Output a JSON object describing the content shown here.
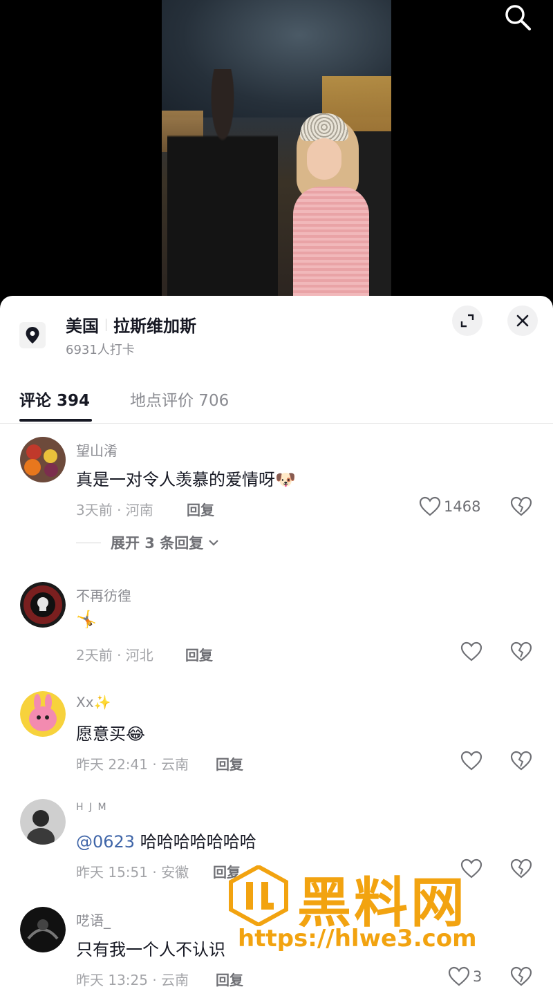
{
  "video": {
    "description_icon": "video-thumbnail"
  },
  "topbar": {
    "search_icon": "search-icon"
  },
  "location": {
    "country": "美国",
    "city": "拉斯维加斯",
    "checkins": "6931人打卡"
  },
  "tabs": [
    {
      "label": "评论 394",
      "active": true
    },
    {
      "label": "地点评价 706",
      "active": false
    }
  ],
  "comments": [
    {
      "user": "望山淆",
      "text": "真是一对令人羡慕的爱情呀",
      "emoji": "🐶",
      "meta": "3天前 · 河南",
      "reply_label": "回复",
      "likes": "1468",
      "expand": "展开 3 条回复"
    },
    {
      "user": "不再彷徨",
      "text": "",
      "emoji": "🤸",
      "meta": "2天前 · 河北",
      "reply_label": "回复",
      "likes": ""
    },
    {
      "user": "Xx✨",
      "text": "愿意买",
      "emoji": "😂",
      "meta": "昨天 22:41 · 云南",
      "reply_label": "回复",
      "likes": ""
    },
    {
      "user": "H J M",
      "mention": "@0623",
      "text": "哈哈哈哈哈哈哈",
      "meta": "昨天 15:51 · 安徽",
      "reply_label": "回复",
      "likes": ""
    },
    {
      "user": "呓语_",
      "text": "只有我一个人不认识",
      "meta": "昨天 13:25 · 云南",
      "reply_label": "回复",
      "likes": "3"
    }
  ],
  "watermark": {
    "title": "黑料网",
    "url": "https://hlwe3.com"
  },
  "colors": {
    "accent": "#161823",
    "mention": "#3f65a8",
    "watermark": "#f2a310"
  }
}
